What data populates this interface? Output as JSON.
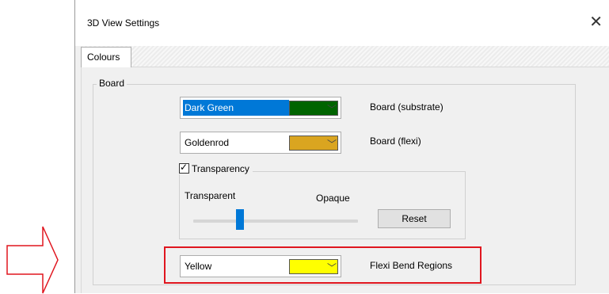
{
  "window": {
    "title": "3D View Settings",
    "close_glyph": "✕"
  },
  "tabs": [
    {
      "label": "Colours",
      "active": true
    }
  ],
  "board_group": {
    "label": "Board",
    "substrate": {
      "value": "Dark Green",
      "swatch_color": "#006400",
      "label": "Board (substrate)"
    },
    "flexi": {
      "value": "Goldenrod",
      "swatch_color": "#DAA520",
      "label": "Board (flexi)"
    },
    "transparency": {
      "checkbox_label": "Transparency",
      "checked": true,
      "left_label": "Transparent",
      "right_label": "Opaque",
      "slider_value": 0.26,
      "reset_label": "Reset"
    },
    "flexi_bend": {
      "value": "Yellow",
      "swatch_color": "#FFFF00",
      "label": "Flexi Bend Regions"
    }
  },
  "colors": {
    "highlight": "#E0161F",
    "selection": "#0078D7",
    "arrow": "#E0161F"
  },
  "icons": {
    "dropdown": "chevron-down-icon",
    "check": "check-icon",
    "close": "close-icon",
    "pointer": "arrow-right-icon"
  }
}
